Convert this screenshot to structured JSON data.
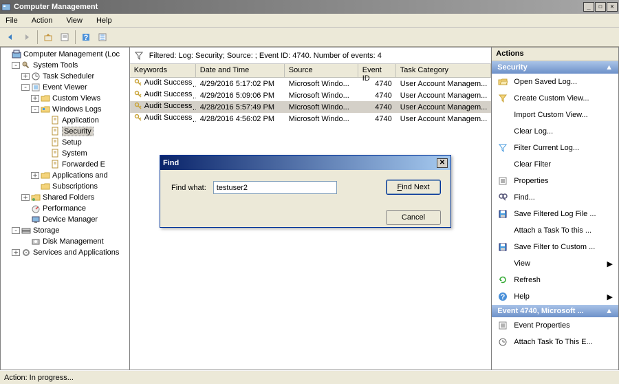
{
  "window": {
    "title": "Computer Management",
    "min": "_",
    "max": "☐",
    "close": "✕"
  },
  "menu": [
    "File",
    "Action",
    "View",
    "Help"
  ],
  "tree": [
    {
      "lvl": 0,
      "exp": "",
      "ic": "mgmt",
      "lbl": "Computer Management (Loc"
    },
    {
      "lvl": 1,
      "exp": "-",
      "ic": "tools",
      "lbl": "System Tools"
    },
    {
      "lvl": 2,
      "exp": "+",
      "ic": "sched",
      "lbl": "Task Scheduler"
    },
    {
      "lvl": 2,
      "exp": "-",
      "ic": "event",
      "lbl": "Event Viewer"
    },
    {
      "lvl": 3,
      "exp": "+",
      "ic": "folder",
      "lbl": "Custom Views"
    },
    {
      "lvl": 3,
      "exp": "-",
      "ic": "folderw",
      "lbl": "Windows Logs"
    },
    {
      "lvl": 4,
      "exp": "",
      "ic": "log",
      "lbl": "Application"
    },
    {
      "lvl": 4,
      "exp": "",
      "ic": "log",
      "lbl": "Security",
      "sel": true
    },
    {
      "lvl": 4,
      "exp": "",
      "ic": "log",
      "lbl": "Setup"
    },
    {
      "lvl": 4,
      "exp": "",
      "ic": "log",
      "lbl": "System"
    },
    {
      "lvl": 4,
      "exp": "",
      "ic": "log",
      "lbl": "Forwarded E"
    },
    {
      "lvl": 3,
      "exp": "+",
      "ic": "folder",
      "lbl": "Applications and"
    },
    {
      "lvl": 3,
      "exp": "",
      "ic": "folder",
      "lbl": "Subscriptions"
    },
    {
      "lvl": 2,
      "exp": "+",
      "ic": "shared",
      "lbl": "Shared Folders"
    },
    {
      "lvl": 2,
      "exp": "",
      "ic": "perf",
      "lbl": "Performance"
    },
    {
      "lvl": 2,
      "exp": "",
      "ic": "dev",
      "lbl": "Device Manager"
    },
    {
      "lvl": 1,
      "exp": "-",
      "ic": "storage",
      "lbl": "Storage"
    },
    {
      "lvl": 2,
      "exp": "",
      "ic": "disk",
      "lbl": "Disk Management"
    },
    {
      "lvl": 1,
      "exp": "+",
      "ic": "services",
      "lbl": "Services and Applications"
    }
  ],
  "filter_text": "Filtered: Log: Security; Source: ; Event ID: 4740. Number of events: 4",
  "columns": [
    "Keywords",
    "Date and Time",
    "Source",
    "Event ID",
    "Task Category"
  ],
  "rows": [
    {
      "k": "Audit Success",
      "dt": "4/29/2016 5:17:02 PM",
      "src": "Microsoft Windo...",
      "id": "4740",
      "tc": "User Account Managem..."
    },
    {
      "k": "Audit Success",
      "dt": "4/29/2016 5:09:06 PM",
      "src": "Microsoft Windo...",
      "id": "4740",
      "tc": "User Account Managem..."
    },
    {
      "k": "Audit Success",
      "dt": "4/28/2016 5:57:49 PM",
      "src": "Microsoft Windo...",
      "id": "4740",
      "tc": "User Account Managem...",
      "sel": true
    },
    {
      "k": "Audit Success",
      "dt": "4/28/2016 4:56:02 PM",
      "src": "Microsoft Windo...",
      "id": "4740",
      "tc": "User Account Managem..."
    }
  ],
  "actions": {
    "hdr": "Actions",
    "sec1": "Security",
    "items1": [
      {
        "ic": "open",
        "lbl": "Open Saved Log..."
      },
      {
        "ic": "create",
        "lbl": "Create Custom View..."
      },
      {
        "ic": "",
        "lbl": "Import Custom View..."
      },
      {
        "ic": "",
        "lbl": "Clear Log..."
      },
      {
        "ic": "filter",
        "lbl": "Filter Current Log..."
      },
      {
        "ic": "",
        "lbl": "Clear Filter"
      },
      {
        "ic": "prop",
        "lbl": "Properties"
      },
      {
        "ic": "find",
        "lbl": "Find..."
      },
      {
        "ic": "save",
        "lbl": "Save Filtered Log File ..."
      },
      {
        "ic": "",
        "lbl": "Attach a Task To this ..."
      },
      {
        "ic": "save",
        "lbl": "Save Filter to Custom ..."
      },
      {
        "ic": "",
        "lbl": "View",
        "arrow": true
      },
      {
        "ic": "refresh",
        "lbl": "Refresh"
      },
      {
        "ic": "help",
        "lbl": "Help",
        "arrow": true
      }
    ],
    "sec2": "Event 4740, Microsoft ...",
    "items2": [
      {
        "ic": "prop",
        "lbl": "Event Properties"
      },
      {
        "ic": "attach",
        "lbl": "Attach Task To This E..."
      }
    ]
  },
  "dialog": {
    "title": "Find",
    "label": "Find what:",
    "value": "testuser2",
    "btn_find": "Find Next",
    "btn_cancel": "Cancel"
  },
  "status": "Action:  In progress..."
}
